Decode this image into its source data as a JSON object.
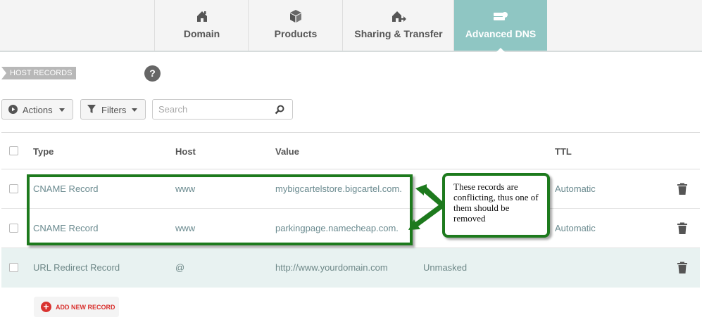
{
  "tabs": [
    {
      "label": "Domain",
      "icon": "house-icon"
    },
    {
      "label": "Products",
      "icon": "box-icon"
    },
    {
      "label": "Sharing & Transfer",
      "icon": "share-house-icon"
    },
    {
      "label": "Advanced DNS",
      "icon": "server-icon",
      "active": true
    }
  ],
  "section": {
    "host_records_label": "HOST RECORDS",
    "help_label": "?"
  },
  "toolbar": {
    "actions_label": "Actions",
    "filters_label": "Filters",
    "search_placeholder": "Search"
  },
  "table": {
    "headers": {
      "type": "Type",
      "host": "Host",
      "value": "Value",
      "ttl": "TTL"
    },
    "rows": [
      {
        "type": "CNAME Record",
        "host": "www",
        "value": "mybigcartelstore.bigcartel.com.",
        "extra": "",
        "ttl": "Automatic"
      },
      {
        "type": "CNAME Record",
        "host": "www",
        "value": "parkingpage.namecheap.com.",
        "extra": "",
        "ttl": "Automatic"
      },
      {
        "type": "URL Redirect Record",
        "host": "@",
        "value": "http://www.yourdomain.com",
        "extra": "Unmasked",
        "ttl": ""
      }
    ]
  },
  "annotation": {
    "note": "These records are conflicting, thus one of them should be removed"
  },
  "add_record": {
    "label": "ADD NEW RECORD"
  },
  "colors": {
    "accent": "#8fc6c3",
    "annotation_green": "#1d7a1d",
    "add_red": "#d9322f"
  }
}
